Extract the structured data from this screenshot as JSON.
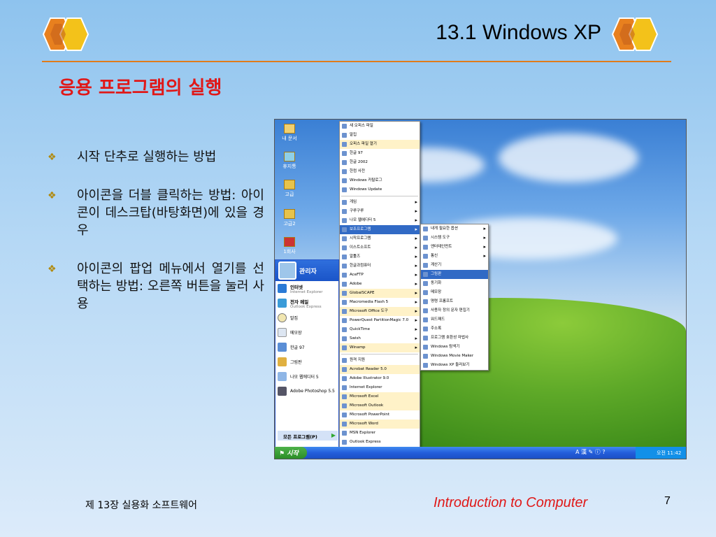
{
  "slide": {
    "title": "13.1 Windows XP",
    "subtitle": "응용 프로그램의 실행",
    "bullets": [
      "시작 단추로 실행하는 방법",
      "아이콘을 더블 클릭하는 방법: 아이콘이 데스크탑(바탕화면)에 있을 경우",
      "아이콘의 팝업 메뉴에서 열기를 선택하는 방법: 오른쪽 버튼을 눌러 사용"
    ],
    "bullet_glyph": "❖",
    "footer_left": "제 13장 실용화 소프트웨어",
    "footer_right": "Introduction to Computer",
    "page_number": "7"
  },
  "colors": {
    "accent_red": "#e01818",
    "rule_orange": "#e07c1a"
  },
  "screenshot": {
    "desktop_icons": [
      "내 문서",
      "휴지통",
      "고급",
      "고급2",
      "1회사"
    ],
    "start_menu": {
      "user": "관리자",
      "pinned": [
        {
          "title": "인터넷",
          "sub": "Internet Explorer"
        },
        {
          "title": "전자 메일",
          "sub": "Outlook Express"
        }
      ],
      "recent": [
        "말집",
        "메모장",
        "한글 97",
        "그림판",
        "나모 웹에디터 5",
        "Adobe Photoshop 5.5"
      ],
      "all_programs": "모든 프로그램(P)"
    },
    "taskbar": {
      "start": "시작",
      "lang": "A 漢 ✎ ⓘ ?",
      "clock": "오전 11:42"
    },
    "programs_menu": [
      "새 오피스 파일",
      "말집",
      "오피스 파일 열기",
      "한글 97",
      "한글 2002",
      "한컴 사전",
      "Windows 카탈로그",
      "Windows Update",
      "게임",
      "구루구루",
      "나모 웹에디터 5",
      "보조프로그램",
      "시작프로그램",
      "이스트소프트",
      "알툴즈",
      "한글과컴퓨터",
      "AceFTP",
      "Adobe",
      "GlobalSCAPE",
      "Macromedia Flash 5",
      "Microsoft Office 도구",
      "PowerQuest PartitionMagic 7.0",
      "QuickTime",
      "Swish",
      "Winamp",
      "원격 지원",
      "Acrobat Reader 5.0",
      "Adobe Illustrator 9.0",
      "Internet Explorer",
      "Microsoft Excel",
      "Microsoft Outlook",
      "Microsoft PowerPoint",
      "Microsoft Word",
      "MSN Explorer",
      "Outlook Express",
      "Windows Media Player",
      "Windows Messenger"
    ],
    "accessories_menu": [
      "내게 필요한 옵션",
      "시스템 도구",
      "엔터테인먼트",
      "통신",
      "계산기",
      "그림판",
      "동기화",
      "메모장",
      "명령 프롬프트",
      "사용자 정의 문자 편집기",
      "워드패드",
      "주소록",
      "프로그램 호환성 마법사",
      "Windows 탐색기",
      "Windows Movie Maker",
      "Windows XP 둘러보기"
    ]
  }
}
